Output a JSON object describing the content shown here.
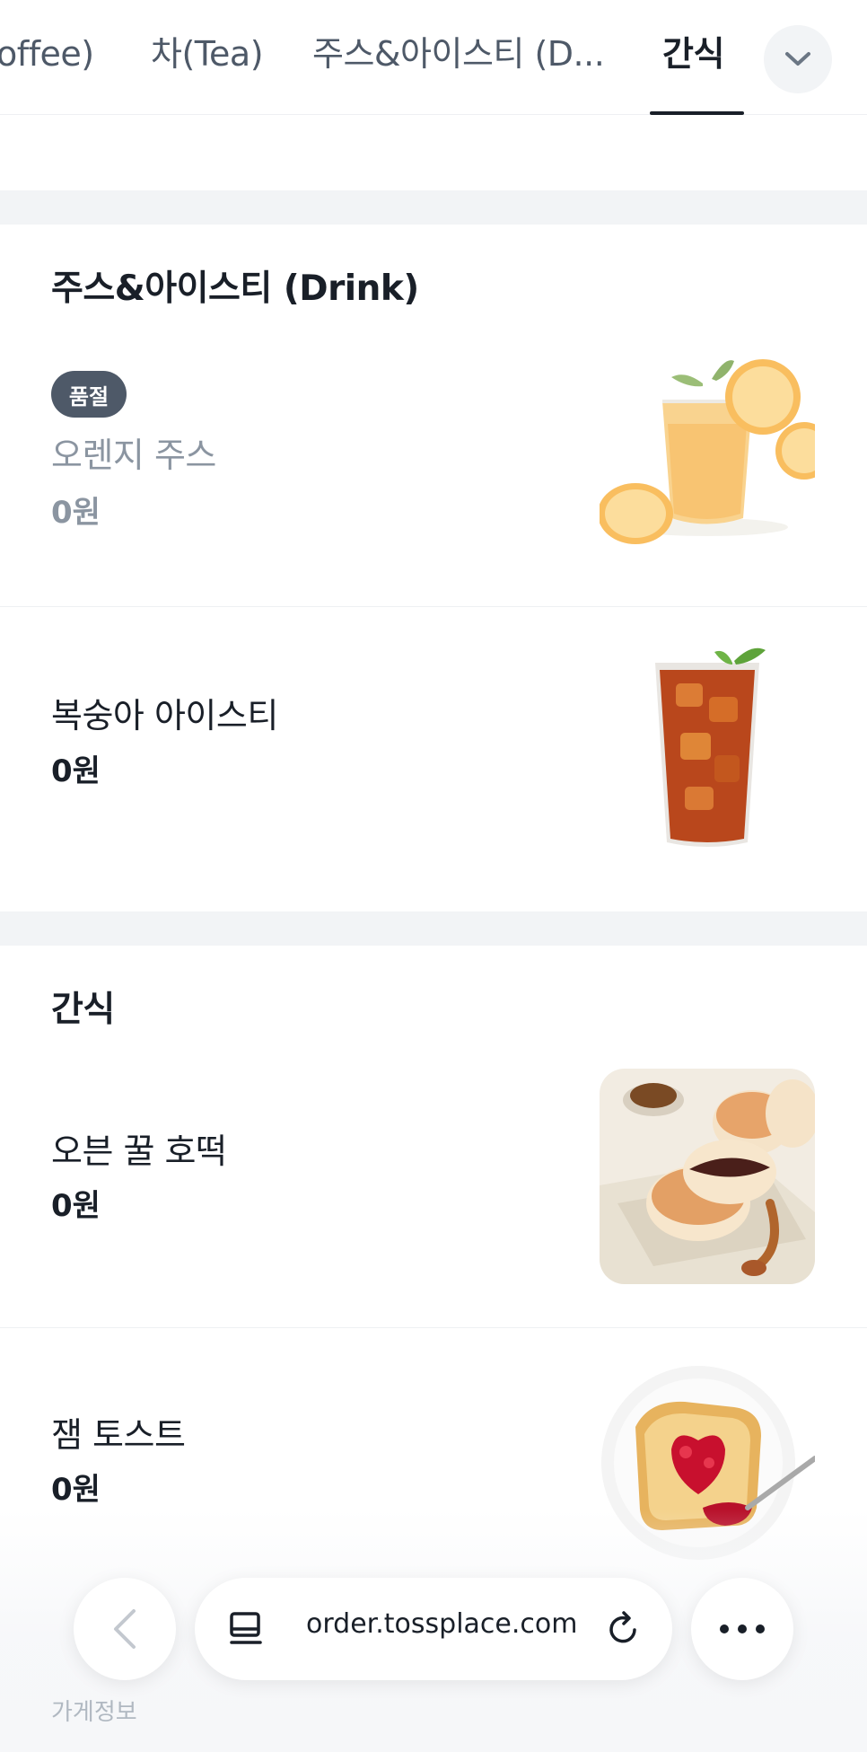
{
  "tabs": [
    {
      "label": "offee)"
    },
    {
      "label": "차(Tea)"
    },
    {
      "label": "주스&아이스티 (D..."
    },
    {
      "label": "간식",
      "active": true
    }
  ],
  "sections": [
    {
      "title": "주스&아이스티 (Drink)",
      "items": [
        {
          "name": "오렌지 주스",
          "price": "0원",
          "badge": "품절",
          "sold_out": true,
          "image": "orange-juice"
        },
        {
          "name": "복숭아 아이스티",
          "price": "0원",
          "image": "iced-tea"
        }
      ]
    },
    {
      "title": "간식",
      "items": [
        {
          "name": "오븐 꿀 호떡",
          "price": "0원",
          "image": "hotteok"
        },
        {
          "name": "잼 토스트",
          "price": "0원",
          "image": "jam-toast"
        }
      ]
    }
  ],
  "footer": {
    "store_info": "가게정보"
  },
  "browser": {
    "url": "order.tossplace.com"
  },
  "colors": {
    "accent": "#191f28",
    "muted": "#8b95a1",
    "background_gap": "#f2f4f6"
  },
  "icons": [
    "chevron-down-icon",
    "chevron-left-icon",
    "tab-switcher-icon",
    "reload-icon",
    "more-icon"
  ]
}
